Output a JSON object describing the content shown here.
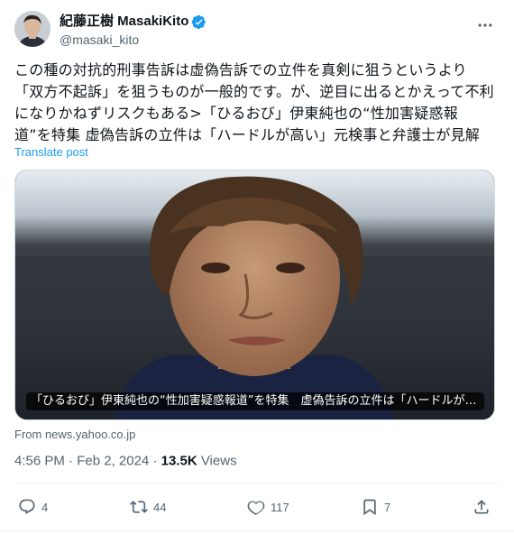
{
  "author": {
    "display_name": "紀藤正樹 MasakiKito",
    "handle": "@masaki_kito",
    "verified": true
  },
  "tweet": {
    "text": "この種の対抗的刑事告訴は虚偽告訴での立件を真剣に狙うというより「双方不起訴」を狙うものが一般的です。が、逆目に出るとかえって不利になりかねずリスクもある>「ひるおび」伊東純也の“性加害疑惑報道”を特集 虚偽告訴の立件は「ハードルが高い」元検事と弁護士が見解",
    "translate_label": "Translate post"
  },
  "card": {
    "title": "「ひるおび」伊東純也の“性加害疑惑報道”を特集　虚偽告訴の立件は「ハードルが高い」...",
    "source": "From news.yahoo.co.jp"
  },
  "meta": {
    "time": "4:56 PM",
    "separator": "·",
    "date": "Feb 2, 2024",
    "views_count": "13.5K",
    "views_label": "Views"
  },
  "actions": {
    "reply_count": "4",
    "repost_count": "44",
    "like_count": "117",
    "bookmark_count": "7"
  },
  "icons": {
    "more": "more-icon",
    "verified": "verified-badge-icon",
    "reply": "reply-icon",
    "repost": "repost-icon",
    "like": "like-icon",
    "bookmark": "bookmark-icon",
    "share": "share-icon"
  },
  "colors": {
    "accent": "#1d9bf0",
    "text": "#0f1419",
    "muted": "#536471"
  }
}
